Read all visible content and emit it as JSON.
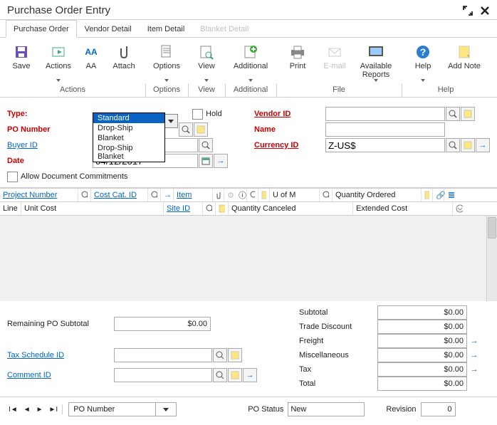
{
  "window": {
    "title": "Purchase Order Entry"
  },
  "tabs": {
    "t0": "Purchase Order",
    "t1": "Vendor Detail",
    "t2": "Item Detail",
    "t3": "Blanket Detail"
  },
  "ribbon": {
    "save": "Save",
    "actions": "Actions",
    "aa": "AA",
    "attach": "Attach",
    "options": "Options",
    "view": "View",
    "additional": "Additional",
    "print": "Print",
    "email": "E-mail",
    "reports": "Available Reports",
    "help": "Help",
    "addnote": "Add Note",
    "group_actions": "Actions",
    "group_options": "Options",
    "group_view": "View",
    "group_additional": "Additional",
    "group_file": "File",
    "group_help": "Help"
  },
  "form": {
    "type_label": "Type:",
    "type_options": {
      "o0": "Standard",
      "o1": "Drop-Ship",
      "o2": "Blanket",
      "o3": "Drop-Ship Blanket"
    },
    "po_number_label": "PO Number",
    "hold_label": "Hold",
    "buyer_id_label": "Buyer ID",
    "date_label": "Date",
    "date_value": "04/12/2017",
    "allow_doc_label": "Allow Document Commitments",
    "vendor_id_label": "Vendor ID",
    "name_label": "Name",
    "currency_id_label": "Currency ID",
    "currency_value": "Z-US$"
  },
  "grid": {
    "project_number": "Project Number",
    "cost_cat": "Cost Cat. ID",
    "item": "Item",
    "uofm": "U of M",
    "qty_ordered": "Quantity Ordered",
    "line": "Line",
    "unit_cost": "Unit Cost",
    "site_id": "Site ID",
    "qty_canceled": "Quantity Canceled",
    "extended_cost": "Extended Cost"
  },
  "totals_left": {
    "remaining_label": "Remaining PO Subtotal",
    "remaining_value": "$0.00",
    "tax_schedule_label": "Tax Schedule ID",
    "comment_label": "Comment ID"
  },
  "totals_right": {
    "subtotal_label": "Subtotal",
    "subtotal_value": "$0.00",
    "trade_label": "Trade Discount",
    "trade_value": "$0.00",
    "freight_label": "Freight",
    "freight_value": "$0.00",
    "misc_label": "Miscellaneous",
    "misc_value": "$0.00",
    "tax_label": "Tax",
    "tax_value": "$0.00",
    "total_label": "Total",
    "total_value": "$0.00"
  },
  "status": {
    "nav_label": "PO Number",
    "po_status_label": "PO Status",
    "po_status_value": "New",
    "revision_label": "Revision",
    "revision_value": "0"
  }
}
